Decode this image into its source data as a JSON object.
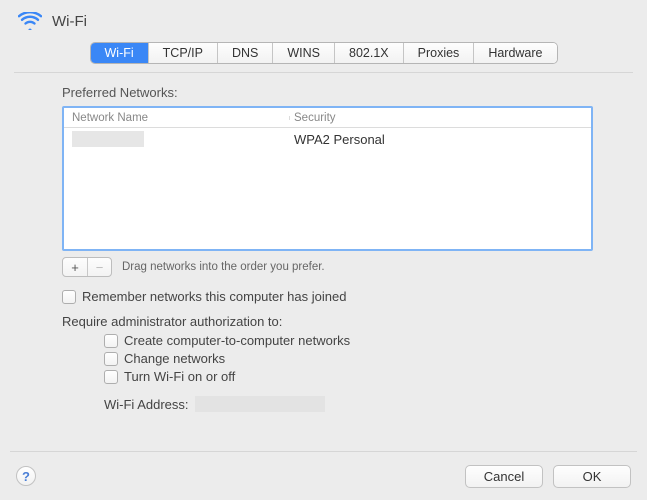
{
  "window_title": "Wi-Fi",
  "tabs": {
    "wifi": "Wi-Fi",
    "tcpip": "TCP/IP",
    "dns": "DNS",
    "wins": "WINS",
    "8021x": "802.1X",
    "proxies": "Proxies",
    "hardware": "Hardware"
  },
  "pref_networks_label": "Preferred Networks:",
  "table": {
    "col_name": "Network Name",
    "col_security": "Security",
    "rows": [
      {
        "name": "",
        "security": "WPA2 Personal"
      }
    ]
  },
  "add_symbol": "+",
  "remove_symbol": "−",
  "drag_hint": "Drag networks into the order you prefer.",
  "remember_label": "Remember networks this computer has joined",
  "require_label": "Require administrator authorization to:",
  "req_opts": {
    "create": "Create computer-to-computer networks",
    "change": "Change networks",
    "toggle": "Turn Wi-Fi on or off"
  },
  "wifi_addr_label": "Wi-Fi Address:",
  "help_symbol": "?",
  "cancel_label": "Cancel",
  "ok_label": "OK"
}
